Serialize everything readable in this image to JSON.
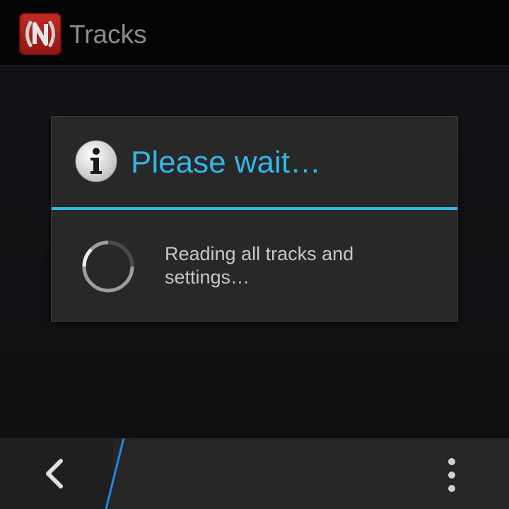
{
  "app": {
    "title": "Tracks",
    "icon": "app-logo-icon",
    "icon_color": "#b5221d"
  },
  "dialog": {
    "title": "Please wait…",
    "title_icon": "info-icon",
    "message": "Reading all tracks and settings…",
    "progress": "indeterminate-spinner",
    "accent_color": "#33b5e5"
  },
  "bottom_bar": {
    "back_icon": "chevron-left-icon",
    "menu_icon": "overflow-menu-icon",
    "accent_color": "#1e88e5"
  }
}
